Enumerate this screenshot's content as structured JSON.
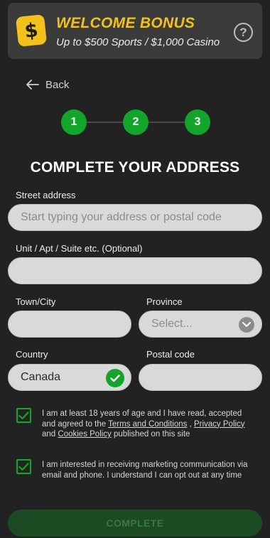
{
  "banner": {
    "icon": "dollar-icon",
    "icon_glyph": "$",
    "title": "WELCOME BONUS",
    "subtitle": "Up to $500 Sports / $1,000 Casino",
    "help_glyph": "?"
  },
  "nav": {
    "back_label": "Back"
  },
  "stepper": {
    "steps": [
      "1",
      "2",
      "3"
    ],
    "current": 3
  },
  "heading": "COMPLETE YOUR ADDRESS",
  "form": {
    "street": {
      "label": "Street address",
      "placeholder": "Start typing your address or postal code"
    },
    "unit": {
      "label": "Unit / Apt / Suite etc. (Optional)",
      "value": ""
    },
    "city": {
      "label": "Town/City",
      "value": ""
    },
    "province": {
      "label": "Province",
      "placeholder": "Select..."
    },
    "country": {
      "label": "Country",
      "value": "Canada"
    },
    "postal": {
      "label": "Postal code",
      "value": ""
    }
  },
  "consents": {
    "terms": {
      "checked": true,
      "text_1": "I am at least 18 years of age and I have read, accepted and agreed to the ",
      "link_terms": "Terms and Conditions",
      "sep": " , ",
      "link_privacy": "Privacy Policy",
      "and": " and ",
      "link_cookies": "Cookies Policy",
      "text_2": " published on this site"
    },
    "marketing": {
      "checked": true,
      "text": "I am interested in receiving marketing communication via email and phone. I understand I can opt out at any time"
    }
  },
  "submit": {
    "label": "COMPLETE"
  },
  "colors": {
    "accent_yellow": "#f2c11b",
    "accent_green": "#12a52a",
    "background": "#222222",
    "disabled_button": "#1b4a23"
  }
}
